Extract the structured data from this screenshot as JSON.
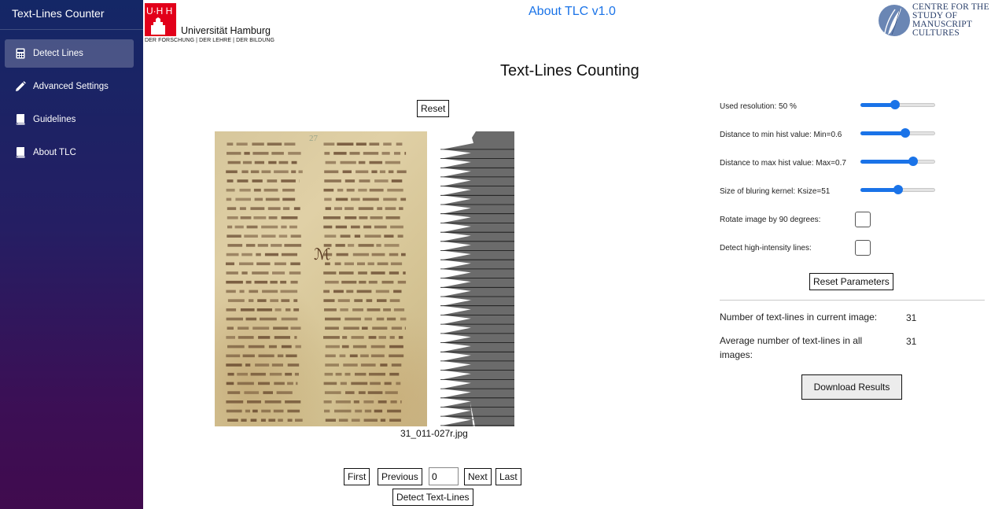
{
  "app": {
    "title": "Text-Lines Counter"
  },
  "sidebar": {
    "items": [
      {
        "label": "Detect Lines",
        "icon": "calculator-icon",
        "active": true
      },
      {
        "label": "Advanced Settings",
        "icon": "pencil-icon",
        "active": false
      },
      {
        "label": "Guidelines",
        "icon": "book-icon",
        "active": false
      },
      {
        "label": "About TLC",
        "icon": "book-icon",
        "active": false
      }
    ]
  },
  "header": {
    "about_link": "About TLC v1.0",
    "uhh_logo": {
      "mark": "U·H H",
      "name": "Universität Hamburg",
      "tagline": "DER FORSCHUNG | DER LEHRE | DER BILDUNG"
    },
    "csmc_logo": {
      "text": "CENTRE FOR THE\nSTUDY OF\nMANUSCRIPT\nCULTURES"
    }
  },
  "main": {
    "title": "Text-Lines Counting",
    "reset_label": "Reset",
    "filename": "31_011-027r.jpg",
    "navigation": {
      "first": "First",
      "previous": "Previous",
      "page_value": "0",
      "next": "Next",
      "last": "Last",
      "detect": "Detect Text-Lines"
    },
    "detected_lines": 31
  },
  "settings": {
    "resolution": {
      "label": "Used resolution: 50 %",
      "fraction": 0.46
    },
    "min_hist": {
      "label": "Distance to min hist value: Min=0.6",
      "fraction": 0.6
    },
    "max_hist": {
      "label": "Distance to max hist value: Max=0.7",
      "fraction": 0.7
    },
    "kernel": {
      "label": "Size of bluring kernel: Ksize=51",
      "fraction": 0.5
    },
    "rotate": {
      "label": "Rotate image by 90 degrees:",
      "checked": false
    },
    "high_intensity": {
      "label": "Detect high-intensity lines:",
      "checked": false
    },
    "reset_params_label": "Reset Parameters"
  },
  "results": {
    "current_label": "Number of text-lines in current image:",
    "current_value": "31",
    "average_label": "Average number of text-lines in all images:",
    "average_value": "31",
    "download_label": "Download Results"
  },
  "colors": {
    "accent": "#1a73e8",
    "sidebar_top": "#142766",
    "sidebar_bottom": "#400b4e",
    "uhh_red": "#e2001a",
    "histogram_gray": "#6b6b6b",
    "ink": "#5a3a22"
  }
}
